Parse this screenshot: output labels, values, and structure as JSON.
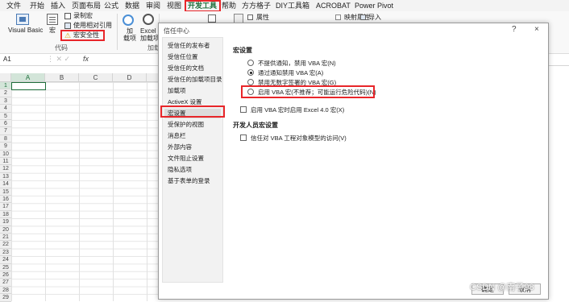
{
  "tabs": [
    "文件",
    "开始",
    "插入",
    "页面布局",
    "公式",
    "数据",
    "审阅",
    "视图",
    "开发工具",
    "帮助",
    "方方格子",
    "DIY工具箱",
    "ACROBAT",
    "Power Pivot"
  ],
  "active_tab": "开发工具",
  "ribbon": {
    "visual_basic": "Visual Basic",
    "macros": "宏",
    "record_macro": "录制宏",
    "relative_ref": "使用相对引用",
    "macro_security": "宏安全性",
    "code_group": "代码",
    "addins": "加\n载项",
    "excel_addins": "Excel\n加载项",
    "addins_group": "加载",
    "properties": "属性",
    "map_properties": "映射属性",
    "import": "导入"
  },
  "formula_bar": {
    "name_box": "A1",
    "fx": "fx"
  },
  "grid": {
    "columns": [
      "A",
      "B",
      "C",
      "D"
    ],
    "rows": [
      "1",
      "2",
      "3",
      "4",
      "5",
      "6",
      "7",
      "8",
      "9",
      "10",
      "11",
      "12",
      "13",
      "14",
      "15",
      "16",
      "17",
      "18",
      "19",
      "20",
      "21",
      "22",
      "23",
      "24",
      "25",
      "26",
      "27",
      "28",
      "29"
    ]
  },
  "dialog": {
    "title": "信任中心",
    "help": "?",
    "close": "×",
    "nav": [
      "受信任的发布者",
      "受信任位置",
      "受信任的文档",
      "受信任的加载项目录",
      "加载项",
      "ActiveX 设置",
      "宏设置",
      "受保护的视图",
      "消息栏",
      "外部内容",
      "文件阻止设置",
      "隐私选项",
      "基于表单的登录"
    ],
    "selected_nav": "宏设置",
    "macro_heading": "宏设置",
    "options": [
      "不提供通知，禁用 VBA 宏(N)",
      "通过通知禁用 VBA 宏(A)",
      "禁用无数字签署的 VBA 宏(G)",
      "启用 VBA 宏(不推荐；可能会运行有潜在危险的代码)(E)"
    ],
    "enable_option_text": "启用 VBA 宏(不推荐；可能运行危险代码)(N)",
    "selected_option": 1,
    "excel4_check": "启用 VBA 宏时启用 Excel 4.0 宏(X)",
    "dev_heading": "开发人员宏设置",
    "trust_vba_check": "信任对 VBA 工程对象模型的访问(V)",
    "ok": "确定",
    "cancel": "取消"
  },
  "watermark": "CSDN @南子98",
  "colors": {
    "excel_green": "#1e6e3b",
    "highlight_red": "#e8262a"
  }
}
